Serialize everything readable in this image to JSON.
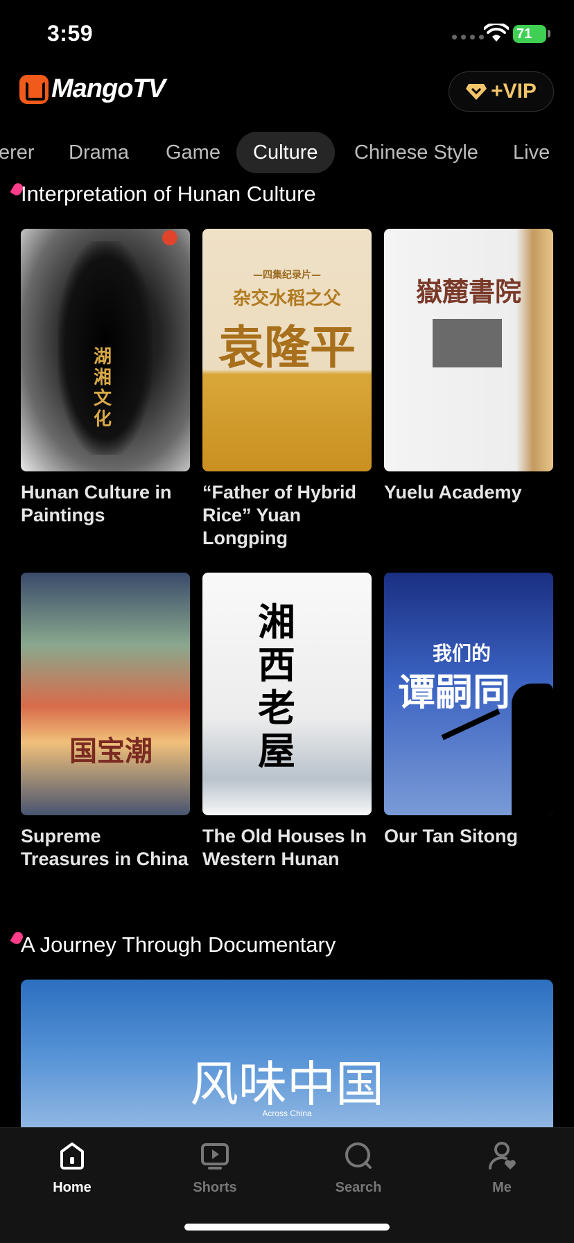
{
  "status_bar": {
    "time": "3:59",
    "battery": "71"
  },
  "header": {
    "brand": "MangoTV",
    "vip_label": "+VIP"
  },
  "tabs": [
    {
      "label": "erer"
    },
    {
      "label": "Drama"
    },
    {
      "label": "Game"
    },
    {
      "label": "Culture",
      "active": true
    },
    {
      "label": "Chinese Style"
    },
    {
      "label": "Live"
    }
  ],
  "sections": [
    {
      "title": "Interpretation of Hunan Culture",
      "items": [
        {
          "title": "Hunan Culture in Paintings",
          "poster_text": "湖湘文化"
        },
        {
          "title": "“Father of Hybrid Rice” Yuan Longping",
          "poster_sub": "—四集纪录片—",
          "poster_mid": "杂交水稻之父",
          "poster_text": "袁隆平"
        },
        {
          "title": "Yuelu Academy",
          "poster_text": "嶽麓書院"
        },
        {
          "title": "Supreme Treasures in China",
          "poster_text": "国宝潮"
        },
        {
          "title": "The Old Houses In Western Hunan",
          "poster_text": "湘西老屋"
        },
        {
          "title": "Our Tan Sitong",
          "poster_sub": "我们的",
          "poster_text": "谭嗣同"
        }
      ]
    },
    {
      "title": "A Journey Through Documentary",
      "banner": {
        "text": "风味中国",
        "sub": "Across China"
      }
    }
  ],
  "bottom_nav": [
    {
      "label": "Home",
      "icon": "home-icon",
      "active": true
    },
    {
      "label": "Shorts",
      "icon": "play-icon"
    },
    {
      "label": "Search",
      "icon": "search-icon"
    },
    {
      "label": "Me",
      "icon": "profile-icon"
    }
  ],
  "colors": {
    "accent_pink": "#ff3d88",
    "vip_gold": "#f3c56b",
    "brand_orange": "#f05a1a"
  }
}
